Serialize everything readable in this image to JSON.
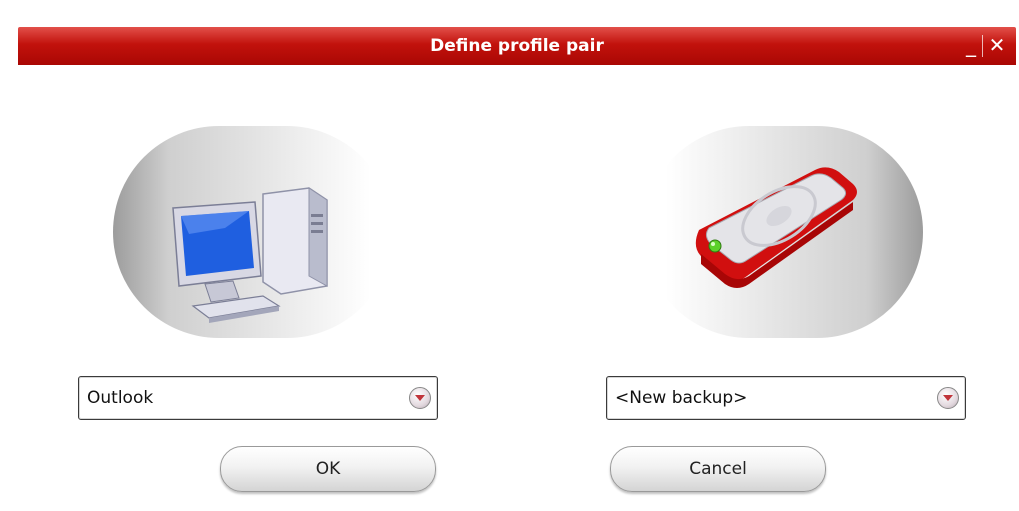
{
  "window": {
    "title": "Define profile pair",
    "minimize_glyph": "_",
    "close_glyph": "✕"
  },
  "source": {
    "icon": "computer-icon",
    "selected": "Outlook"
  },
  "target": {
    "icon": "hard-drive-icon",
    "selected": "<New backup>"
  },
  "buttons": {
    "ok_label": "OK",
    "cancel_label": "Cancel"
  },
  "colors": {
    "titlebar": "#c2120c",
    "drive_accent": "#d10f0f",
    "screen_blue": "#1f5fe0"
  }
}
